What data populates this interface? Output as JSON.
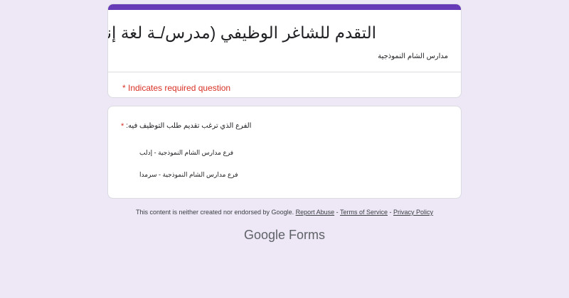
{
  "form": {
    "title": "التقدم للشاغر الوظيفي (مدرس/ـة لغة إنكليزية)",
    "subtitle": "مدارس الشام النموذجية",
    "required_note": "* Indicates required question",
    "accent_color": "#673ab7"
  },
  "question": {
    "required_mark": "*",
    "text": "الفرع الذي ترغب تقديم طلب التوظيف فيه:",
    "options": [
      {
        "label": "فرع مدارس الشام النموذجية - إدلب"
      },
      {
        "label": "فرع مدارس الشام النموذجية - سرمدا"
      }
    ]
  },
  "footer": {
    "disclaimer": "This content is neither created nor endorsed by Google.",
    "report_abuse": "Report Abuse",
    "sep1": " - ",
    "terms": "Terms of Service",
    "sep2": " - ",
    "privacy": "Privacy Policy"
  },
  "brand": {
    "google": "Google",
    "forms": "Forms"
  }
}
